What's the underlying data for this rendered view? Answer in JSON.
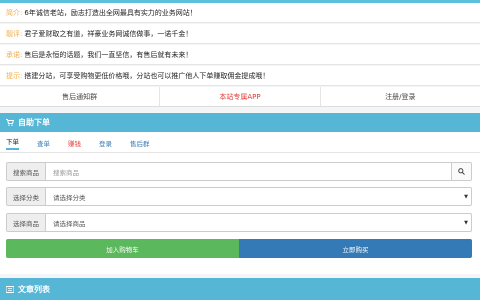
{
  "notices": [
    {
      "tag": "简介:",
      "text": "6年诚信老站，励志打造出全网最具有实力的业务网站！"
    },
    {
      "tag": "靓评:",
      "text": "君子爱财取之有道，祥豪业务网诚信做事，一诺千金！"
    },
    {
      "tag": "承诺:",
      "text": "售后是永恒的话题，我们一直坚信，有售后就有未来！"
    },
    {
      "tag": "提示:",
      "text": "搭建分站，可享受购物更低价格哦，分站也可以推广他人下单赚取佣金提成哦！"
    }
  ],
  "links": [
    {
      "label": "售后通知群"
    },
    {
      "label": "本站专属APP"
    },
    {
      "label": "注册/登录"
    }
  ],
  "order_panel": {
    "title": "自助下单",
    "tabs": [
      {
        "label": "下单"
      },
      {
        "label": "查单"
      },
      {
        "label": "赚钱"
      },
      {
        "label": "登录"
      },
      {
        "label": "售后群"
      }
    ],
    "search": {
      "label": "搜索商品",
      "placeholder": "搜索商品"
    },
    "category": {
      "label": "选择分类",
      "value": "请选择分类"
    },
    "product": {
      "label": "选择商品",
      "value": "请选择商品"
    },
    "add_cart": "加入购物车",
    "buy_now": "立即购买"
  },
  "article_panel": {
    "title": "文章列表"
  },
  "colors": {
    "header_bg": "#56b6d6",
    "tag_orange": "#f0ad4e",
    "green": "#5cb85c",
    "blue": "#337ab7",
    "red_link": "#e53935"
  }
}
